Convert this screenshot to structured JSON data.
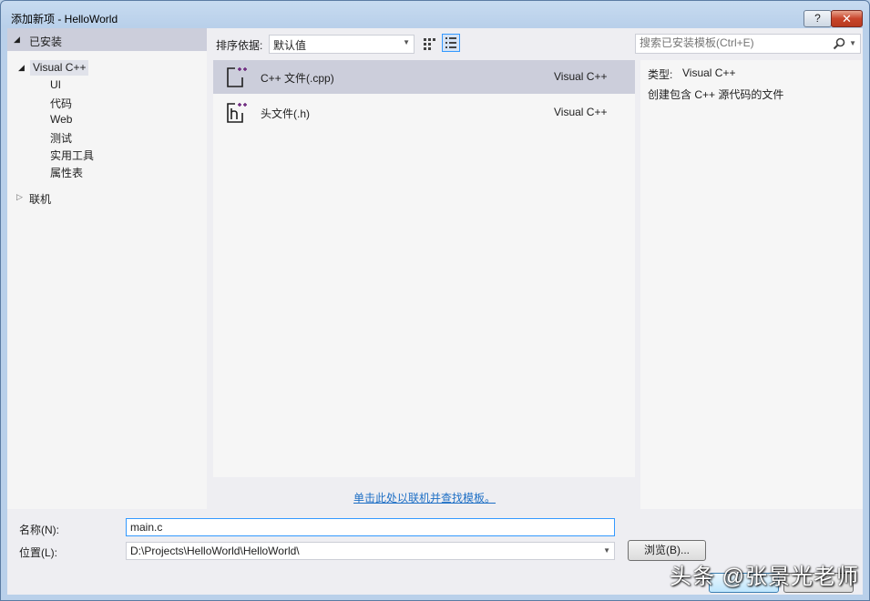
{
  "window": {
    "title": "添加新项 - HelloWorld",
    "help_label": "?",
    "close_label": "✕"
  },
  "sidebar": {
    "header": "已安装",
    "tree": {
      "root_label": "Visual C++",
      "children": [
        "UI",
        "代码",
        "Web",
        "测试",
        "实用工具",
        "属性表"
      ],
      "online_label": "联机"
    }
  },
  "toolbar": {
    "sort_label": "排序依据:",
    "sort_value": "默认值",
    "view_modes": [
      "grid-view",
      "list-view"
    ],
    "active_view": "list-view"
  },
  "templates": [
    {
      "name": "C++ 文件(.cpp)",
      "language": "Visual C++",
      "icon": "cpp-file-icon",
      "selected": true
    },
    {
      "name": "头文件(.h)",
      "language": "Visual C++",
      "icon": "header-file-icon",
      "selected": false
    }
  ],
  "online_link": "单击此处以联机并查找模板。",
  "search": {
    "placeholder": "搜索已安装模板(Ctrl+E)"
  },
  "details": {
    "type_label": "类型:",
    "type_value": "Visual C++",
    "description": "创建包含 C++ 源代码的文件"
  },
  "form": {
    "name_label": "名称(N):",
    "name_value": "main.c",
    "location_label": "位置(L):",
    "location_value": "D:\\Projects\\HelloWorld\\HelloWorld\\",
    "browse_label": "浏览(B)..."
  },
  "watermark": "头条 @张景光老师",
  "colors": {
    "accent": "#3399ff",
    "link": "#1e6fc5",
    "selected_row": "#cccedb",
    "icon_accent": "#68217a"
  }
}
